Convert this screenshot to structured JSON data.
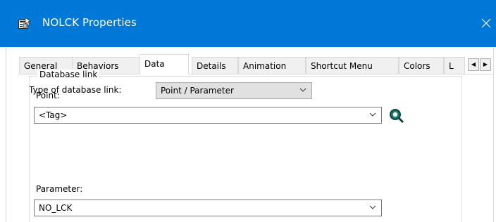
{
  "window": {
    "title": "NOLCK Properties",
    "icon": "properties-icon",
    "close_icon": "close-icon",
    "accent": "#0078d7"
  },
  "tabs": [
    {
      "label": "General"
    },
    {
      "label": "Behaviors"
    },
    {
      "label": "Data",
      "active": true
    },
    {
      "label": "Details"
    },
    {
      "label": "Animation"
    },
    {
      "label": "Shortcut Menu"
    },
    {
      "label": "Colors"
    },
    {
      "label": "L"
    }
  ],
  "form": {
    "link_type_label": "Type of database link:",
    "link_type_value": "Point / Parameter",
    "group_label": "Database link",
    "point_label": "Point:",
    "point_value": "<Tag>",
    "parameter_label": "Parameter:",
    "parameter_value": "NO_LCK"
  }
}
